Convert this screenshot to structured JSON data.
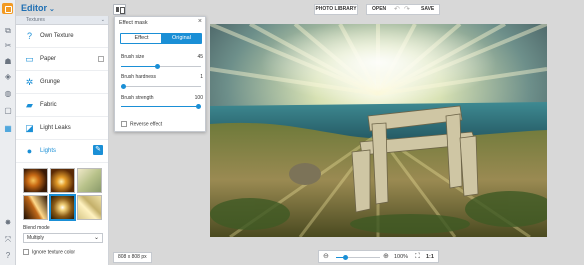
{
  "app": {
    "title": "Editor"
  },
  "toolstrip": {
    "tools": [
      {
        "name": "crop-icon",
        "glyph": "⧉"
      },
      {
        "name": "tools-icon",
        "glyph": "✂"
      },
      {
        "name": "touch-up-icon",
        "glyph": "☗"
      },
      {
        "name": "filters-icon",
        "glyph": "◈"
      },
      {
        "name": "effects-icon",
        "glyph": "◍"
      },
      {
        "name": "frames-icon",
        "glyph": "▢"
      },
      {
        "name": "textures-icon",
        "glyph": "▦"
      }
    ],
    "bottom": [
      {
        "name": "bulb-icon",
        "glyph": "✸"
      },
      {
        "name": "fullscreen-icon",
        "glyph": "⤧"
      },
      {
        "name": "help-icon",
        "glyph": "?"
      }
    ]
  },
  "panel": {
    "section": "Textures",
    "categories": [
      {
        "label": "Own Texture",
        "icon": "question-box-icon",
        "glyph": "?"
      },
      {
        "label": "Paper",
        "icon": "paper-icon",
        "glyph": "▭"
      },
      {
        "label": "Grunge",
        "icon": "grunge-icon",
        "glyph": "✲"
      },
      {
        "label": "Fabric",
        "icon": "fabric-icon",
        "glyph": "▰"
      },
      {
        "label": "Light Leaks",
        "icon": "light-leaks-icon",
        "glyph": "◪"
      },
      {
        "label": "Lights",
        "icon": "lights-icon",
        "glyph": "●"
      }
    ],
    "blend_mode_label": "Blend mode",
    "blend_mode_value": "Multiply",
    "ignore_label": "Ignore texture color"
  },
  "topbar": {
    "photo_library": "PHOTO LIBRARY",
    "open": "OPEN",
    "undo": "↶",
    "redo": "↷",
    "save": "SAVE"
  },
  "mask": {
    "title": "Effect mask",
    "close": "×",
    "tab_effect": "Effect",
    "tab_original": "Original",
    "sliders": [
      {
        "label": "Brush size",
        "value": "45",
        "fraction": 0.45
      },
      {
        "label": "Brush hardness",
        "value": "1",
        "fraction": 0.01
      },
      {
        "label": "Brush strength",
        "value": "100",
        "fraction": 1.0
      }
    ],
    "reverse_label": "Reverse effect"
  },
  "bottombar": {
    "dimensions": "808 x 808 px",
    "zoom_out": "⊖",
    "zoom_in": "⊕",
    "zoom_value": "100%",
    "zoom_fraction": 0.2,
    "fit": "⛶",
    "one_to_one": "1:1"
  },
  "colors": {
    "accent": "#1a8fd6",
    "brand": "#f29a22"
  }
}
